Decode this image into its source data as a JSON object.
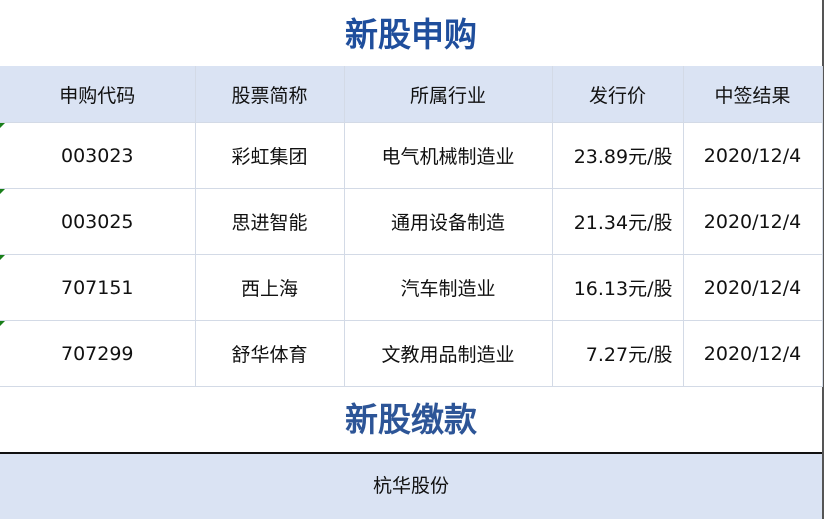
{
  "section1": {
    "title": "新股申购",
    "headers": [
      "申购代码",
      "股票简称",
      "所属行业",
      "发行价",
      "中签结果"
    ],
    "rows": [
      {
        "code": "003023",
        "name": "彩虹集团",
        "industry": "电气机械制造业",
        "price": "23.89元/股",
        "result": "2020/12/4"
      },
      {
        "code": "003025",
        "name": "思进智能",
        "industry": "通用设备制造",
        "price": "21.34元/股",
        "result": "2020/12/4"
      },
      {
        "code": "707151",
        "name": "西上海",
        "industry": "汽车制造业",
        "price": "16.13元/股",
        "result": "2020/12/4"
      },
      {
        "code": "707299",
        "name": "舒华体育",
        "industry": "文教用品制造业",
        "price": "7.27元/股",
        "result": "2020/12/4"
      }
    ]
  },
  "section2": {
    "title": "新股缴款",
    "stock": "杭华股份"
  },
  "colors": {
    "title": "#1f4e9c",
    "header_bg": "#dae3f3",
    "grid_line": "#d3dae6",
    "corner_marker": "#1a7f1a"
  }
}
